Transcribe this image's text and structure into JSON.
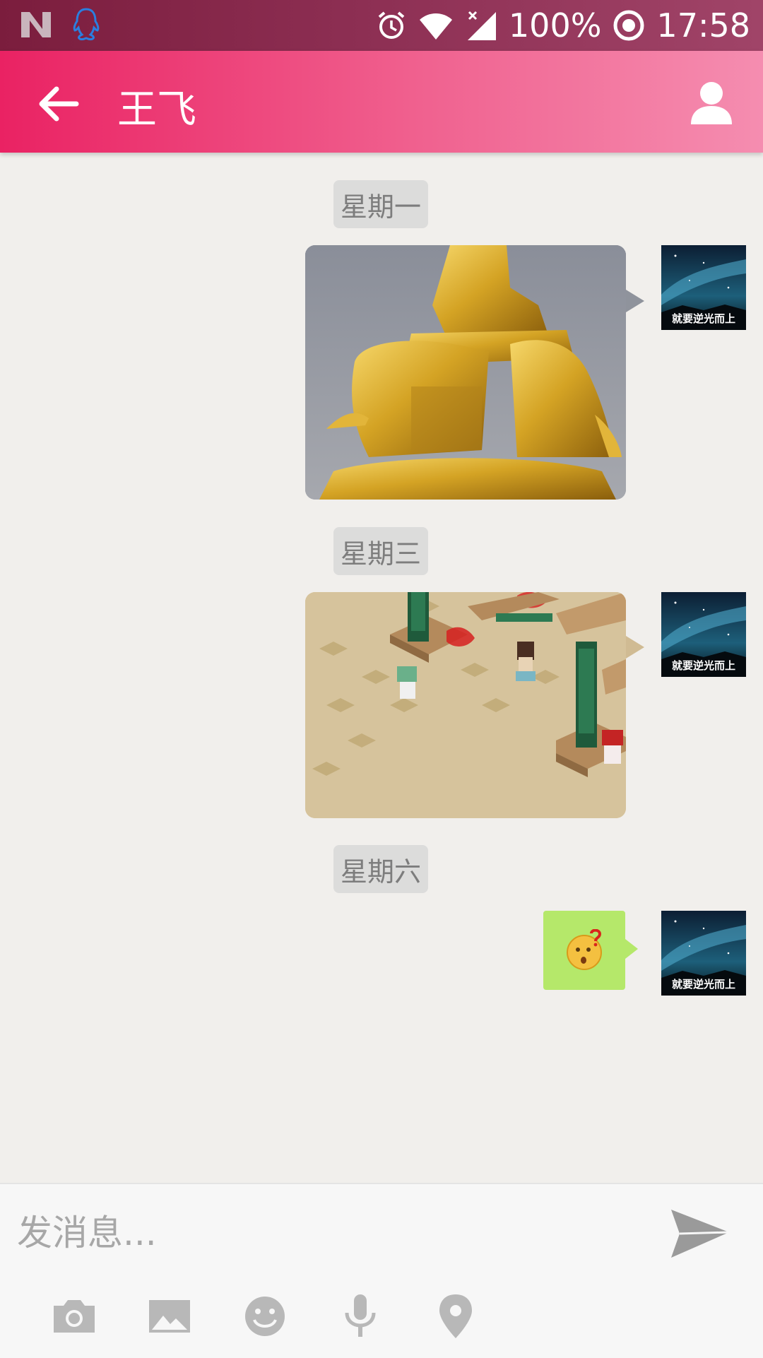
{
  "status_bar": {
    "battery": "100%",
    "time": "17:58"
  },
  "header": {
    "title": "王飞"
  },
  "chat": {
    "date_labels": [
      "星期一",
      "星期三",
      "星期六"
    ],
    "avatar_caption": "就要逆光而上",
    "sticker_emoji": "😯❓"
  },
  "composer": {
    "placeholder": "发消息...",
    "toolbar": [
      "camera-icon",
      "image-icon",
      "emoji-icon",
      "mic-icon",
      "location-icon"
    ]
  },
  "colors": {
    "header_start": "#ea2263",
    "header_end": "#f58db0",
    "sticker_bubble": "#b5e86a",
    "icon_gray": "#b8b8b8"
  }
}
